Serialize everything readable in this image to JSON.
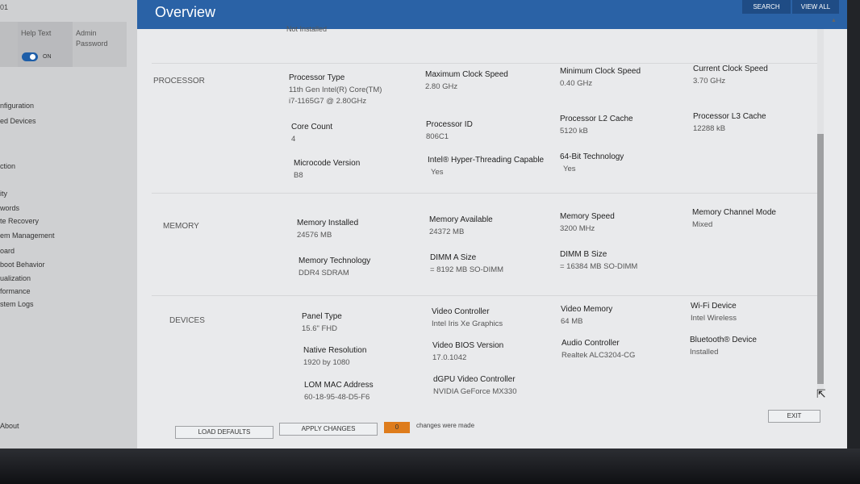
{
  "top_left_fragment": "01",
  "header": {
    "title": "Overview",
    "search": "SEARCH",
    "view_all": "VIEW ALL"
  },
  "sidebar": {
    "tiles": {
      "help_text": "Help Text",
      "admin_password_line1": "Admin",
      "admin_password_line2": "Password",
      "toggle_state": "ON"
    },
    "items": [
      "nfiguration",
      "ed Devices",
      "ction",
      "ity",
      "words",
      "te Recovery",
      "em Management",
      "oard",
      "boot Behavior",
      "ualization",
      "formance",
      "stem Logs"
    ],
    "about": "About"
  },
  "main": {
    "cut_off_text": "Not Installed",
    "sections": {
      "processor": "PROCESSOR",
      "memory": "MEMORY",
      "devices": "DEVICES"
    },
    "processor": {
      "type": {
        "label": "Processor Type",
        "line1": "11th Gen Intel(R) Core(TM)",
        "line2": "i7-1165G7 @ 2.80GHz"
      },
      "max_clock": {
        "label": "Maximum Clock Speed",
        "value": "2.80 GHz"
      },
      "min_clock": {
        "label": "Minimum Clock Speed",
        "value": "0.40 GHz"
      },
      "current_clock": {
        "label": "Current Clock Speed",
        "value": "3.70 GHz"
      },
      "core_count": {
        "label": "Core Count",
        "value": "4"
      },
      "processor_id": {
        "label": "Processor ID",
        "value": "806C1"
      },
      "l2_cache": {
        "label": "Processor L2 Cache",
        "value": "5120 kB"
      },
      "l3_cache": {
        "label": "Processor L3 Cache",
        "value": "12288 kB"
      },
      "microcode": {
        "label": "Microcode Version",
        "value": "B8"
      },
      "hyperthreading": {
        "label": "Intel® Hyper-Threading Capable",
        "value": "Yes"
      },
      "bit64": {
        "label": "64-Bit Technology",
        "value": "Yes"
      }
    },
    "memory": {
      "installed": {
        "label": "Memory Installed",
        "value": "24576 MB"
      },
      "available": {
        "label": "Memory Available",
        "value": "24372 MB"
      },
      "speed": {
        "label": "Memory Speed",
        "value": "3200 MHz"
      },
      "channel_mode": {
        "label": "Memory Channel Mode",
        "value": "Mixed"
      },
      "technology": {
        "label": "Memory Technology",
        "value": "DDR4 SDRAM"
      },
      "dimm_a": {
        "label": "DIMM A Size",
        "value": "= 8192 MB SO-DIMM"
      },
      "dimm_b": {
        "label": "DIMM B Size",
        "value": "= 16384 MB SO-DIMM"
      }
    },
    "devices": {
      "panel_type": {
        "label": "Panel Type",
        "value": "15.6\" FHD"
      },
      "video_controller": {
        "label": "Video Controller",
        "value": "Intel Iris Xe Graphics"
      },
      "video_memory": {
        "label": "Video Memory",
        "value": "64 MB"
      },
      "wifi": {
        "label": "Wi-Fi Device",
        "value": "Intel Wireless"
      },
      "native_resolution": {
        "label": "Native Resolution",
        "value": "1920 by 1080"
      },
      "video_bios": {
        "label": "Video BIOS Version",
        "value": "17.0.1042"
      },
      "audio_controller": {
        "label": "Audio Controller",
        "value": "Realtek ALC3204-CG"
      },
      "bluetooth": {
        "label": "Bluetooth® Device",
        "value": "Installed"
      },
      "lom_mac": {
        "label": "LOM MAC Address",
        "value": "60-18-95-48-D5-F6"
      },
      "dgpu": {
        "label": "dGPU Video Controller",
        "value": "NVIDIA GeForce MX330"
      }
    }
  },
  "footer": {
    "load_defaults": "LOAD DEFAULTS",
    "apply_changes": "APPLY CHANGES",
    "changes_count": "0",
    "changes_text": "changes were made",
    "exit": "EXIT"
  },
  "colors": {
    "header_blue": "#2a62a6",
    "accent_orange": "#de7c1c",
    "toggle_blue": "#1e5ea8"
  }
}
